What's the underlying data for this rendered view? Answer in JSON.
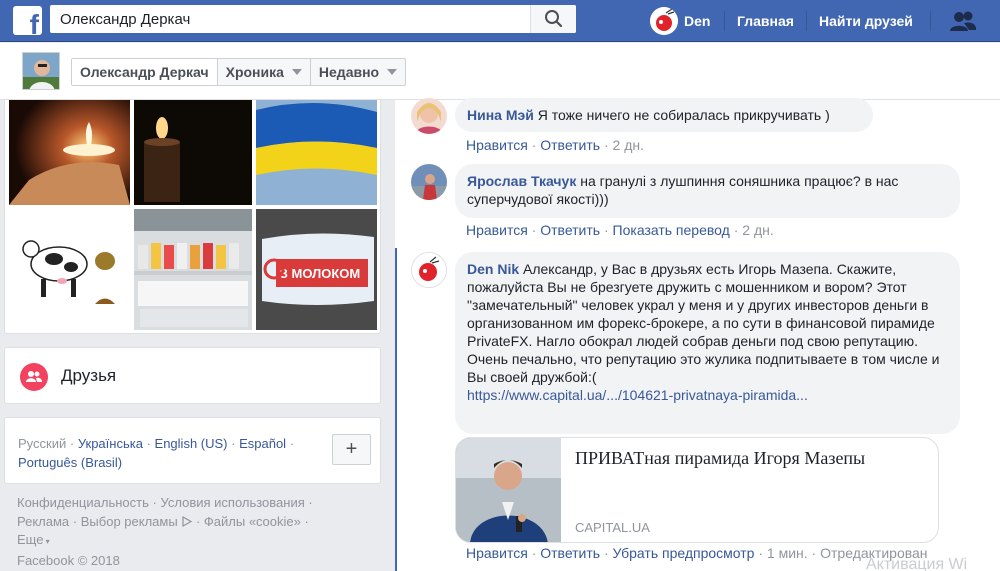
{
  "topbar": {
    "logo": "f",
    "search_value": "Олександр Деркач",
    "search_icon": "search-icon",
    "user_name": "Den",
    "home_label": "Главная",
    "find_friends_label": "Найти друзей",
    "friends_icon": "friend-requests-icon"
  },
  "profile_bar": {
    "name": "Олександр Деркач",
    "timeline_label": "Хроника",
    "recent_label": "Недавно"
  },
  "friends_section": {
    "label": "Друзья"
  },
  "photo_labels": {
    "milk_brand": "З МОЛОКОМ"
  },
  "languages": {
    "current": "Русский",
    "items": [
      "Українська",
      "English (US)",
      "Español",
      "Português (Brasil)"
    ],
    "separator": "·",
    "add_label": "+"
  },
  "footer": {
    "links": [
      "Конфиденциальность",
      "Условия использования",
      "Реклама",
      "Выбор рекламы",
      "Файлы «cookie»",
      "Еще"
    ],
    "separator": "·",
    "copyright": "Facebook © 2018"
  },
  "comments": [
    {
      "author": "Нина Мэй",
      "text": "Я тоже ничего не собиралась прикручивать )",
      "actions": [
        "Нравится",
        "Ответить"
      ],
      "time": "2 дн."
    },
    {
      "author": "Ярослав Ткачук",
      "text": "на гранулі з лушпиння соняшника працює? в нас суперчудової якості)))",
      "actions": [
        "Нравится",
        "Ответить",
        "Показать перевод"
      ],
      "time": "2 дн."
    },
    {
      "author": "Den Nik",
      "text": "Александр, у Вас в друзьях есть Игорь Мазепа. Скажите, пожалуйста Вы не брезгуете дружить с мошенником и вором? Этот \"замечательный\" человек украл у меня и у других инвесторов деньги в организованном им форекс-брокере, а по сути в финансовой пирамиде PrivateFX. Нагло обокрал людей собрав деньги под свою репутацию.",
      "text2": "Очень печально, что репутацию это жулика подпитываете в том числе и Вы своей дружбой:(",
      "link": "https://www.capital.ua/.../104621-privatnaya-piramida...",
      "actions": [
        "Нравится",
        "Ответить",
        "Убрать предпросмотр"
      ],
      "time": "1 мин.",
      "edited": "Отредактирован"
    }
  ],
  "preview": {
    "title": "ПРИВАТная пирамида Игоря Мазепы",
    "domain": "CAPITAL.UA"
  },
  "watermark": "Активация Wi",
  "colors": {
    "brand": "#4267b2",
    "link": "#385898",
    "muted": "#90949c"
  }
}
